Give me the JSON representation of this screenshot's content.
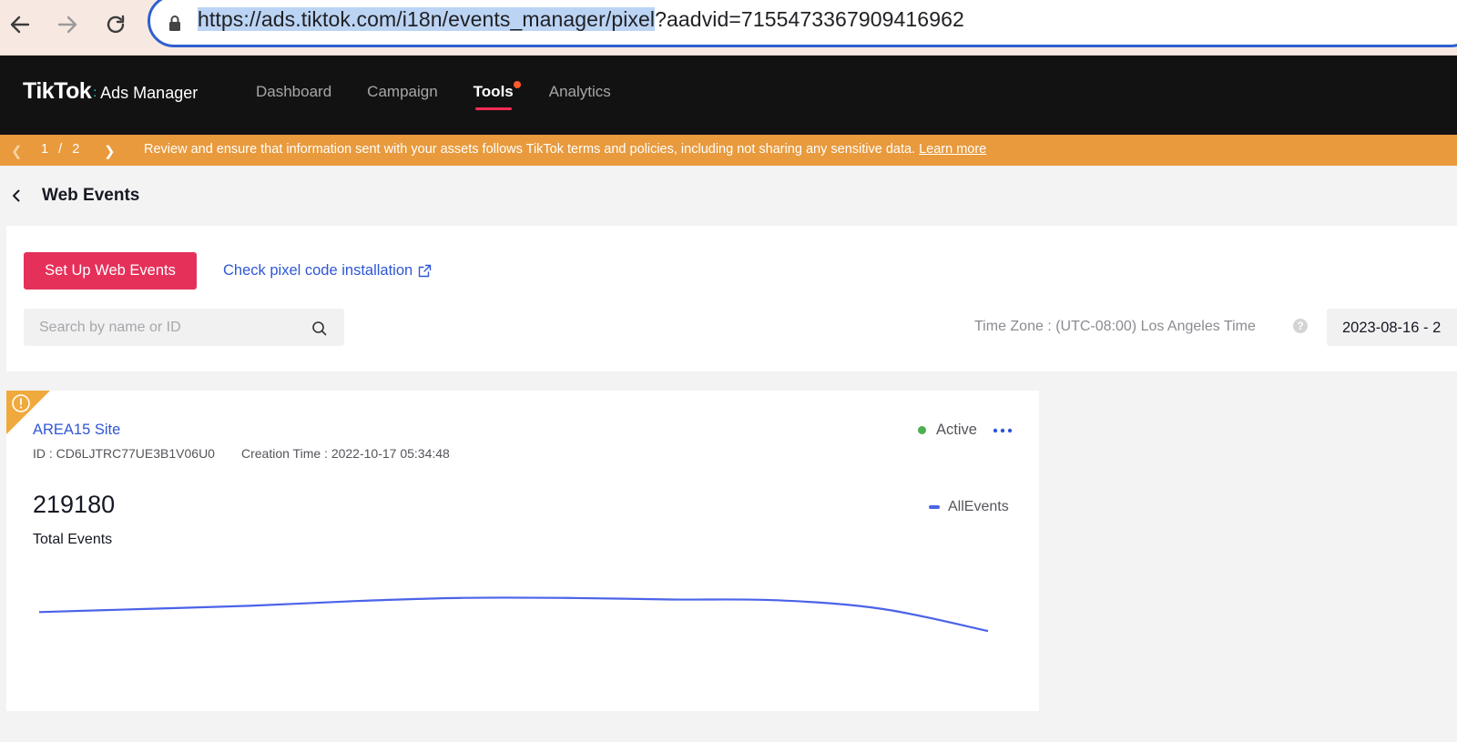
{
  "browser": {
    "url_selected": "https://ads.tiktok.com/i18n/events_manager/pixel",
    "url_rest": "?aadvid=7155473367909416962"
  },
  "header": {
    "logo_main": "TikTok",
    "logo_sub": "Ads Manager",
    "nav": [
      {
        "label": "Dashboard",
        "active": false
      },
      {
        "label": "Campaign",
        "active": false
      },
      {
        "label": "Tools",
        "active": true
      },
      {
        "label": "Analytics",
        "active": false
      }
    ]
  },
  "banner": {
    "page_current": "1",
    "page_sep": "/",
    "page_total": "2",
    "message": "Review and ensure that information sent with your assets follows TikTok terms and policies, including not sharing any sensitive data.",
    "link": "Learn more"
  },
  "page": {
    "title": "Web Events"
  },
  "toolbar": {
    "setup_button": "Set Up Web Events",
    "check_link": "Check pixel code installation",
    "search_placeholder": "Search by name or ID",
    "timezone": "Time Zone : (UTC-08:00) Los Angeles Time",
    "help": "?",
    "date_range": "2023-08-16  -  2"
  },
  "pixel": {
    "name": "AREA15 Site",
    "id": "ID : CD6LJTRC77UE3B1V06U0",
    "created": "Creation Time : 2022-10-17 05:34:48",
    "status": "Active",
    "total_value": "219180",
    "total_label": "Total Events",
    "legend": "AllEvents"
  },
  "colors": {
    "accent": "#e5305a",
    "link": "#2f57d6",
    "line": "#4b63e8",
    "banner": "#e89a3d",
    "active_dot": "#4caf50"
  },
  "chart_data": {
    "type": "line",
    "series": [
      {
        "name": "AllEvents",
        "values": [
          100,
          104,
          108,
          114,
          118,
          118,
          116,
          115,
          104,
          76
        ]
      }
    ],
    "ylim": [
      0,
      150
    ],
    "grid": false
  }
}
